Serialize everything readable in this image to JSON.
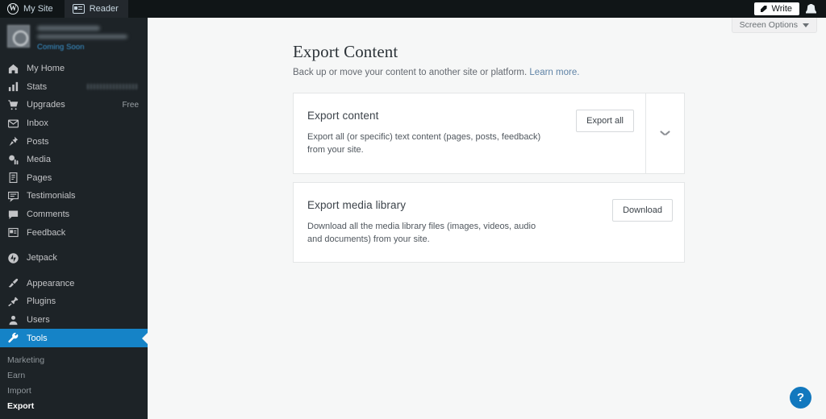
{
  "masterbar": {
    "wp_logo_name": "wordpress-logo-icon",
    "my_site_label": "My Site",
    "reader_label": "Reader",
    "write_label": "Write",
    "bell_name": "notifications-bell-icon"
  },
  "sidebar": {
    "site": {
      "coming_soon_label": "Coming Soon"
    },
    "items": [
      {
        "label": "My Home",
        "icon": "home-icon",
        "badge": ""
      },
      {
        "label": "Stats",
        "icon": "stats-bars-icon",
        "badge": ""
      },
      {
        "label": "Upgrades",
        "icon": "cart-icon",
        "badge": "Free"
      },
      {
        "label": "Inbox",
        "icon": "envelope-icon",
        "badge": ""
      },
      {
        "label": "Posts",
        "icon": "pin-icon",
        "badge": ""
      },
      {
        "label": "Media",
        "icon": "media-icon",
        "badge": ""
      },
      {
        "label": "Pages",
        "icon": "page-icon",
        "badge": ""
      },
      {
        "label": "Testimonials",
        "icon": "testimonial-icon",
        "badge": ""
      },
      {
        "label": "Comments",
        "icon": "comment-icon",
        "badge": ""
      },
      {
        "label": "Feedback",
        "icon": "feedback-icon",
        "badge": ""
      },
      {
        "label": "Jetpack",
        "icon": "jetpack-icon",
        "badge": ""
      },
      {
        "label": "Appearance",
        "icon": "paintbrush-icon",
        "badge": ""
      },
      {
        "label": "Plugins",
        "icon": "plug-icon",
        "badge": ""
      },
      {
        "label": "Users",
        "icon": "user-icon",
        "badge": ""
      },
      {
        "label": "Tools",
        "icon": "wrench-icon",
        "badge": ""
      }
    ],
    "submenu": [
      {
        "label": "Marketing",
        "current": false
      },
      {
        "label": "Earn",
        "current": false
      },
      {
        "label": "Import",
        "current": false
      },
      {
        "label": "Export",
        "current": true
      }
    ]
  },
  "screen_options": {
    "label": "Screen Options"
  },
  "page": {
    "title": "Export Content",
    "subtitle": "Back up or move your content to another site or platform.",
    "learn_more": "Learn more."
  },
  "cards": [
    {
      "title": "Export content",
      "description": "Export all (or specific) text content (pages, posts, feedback) from your site.",
      "button": "Export all",
      "has_toggle": true
    },
    {
      "title": "Export media library",
      "description": "Download all the media library files (images, videos, audio and documents) from your site.",
      "button": "Download",
      "has_toggle": false
    }
  ],
  "help": {
    "label": "?"
  },
  "colors": {
    "masterbar": "#101517",
    "sidebar": "#1d2327",
    "selected": "#1583c7",
    "accent_link": "#5f83a6",
    "help_fab": "#1278be",
    "content_bg": "#f6f7f7"
  }
}
